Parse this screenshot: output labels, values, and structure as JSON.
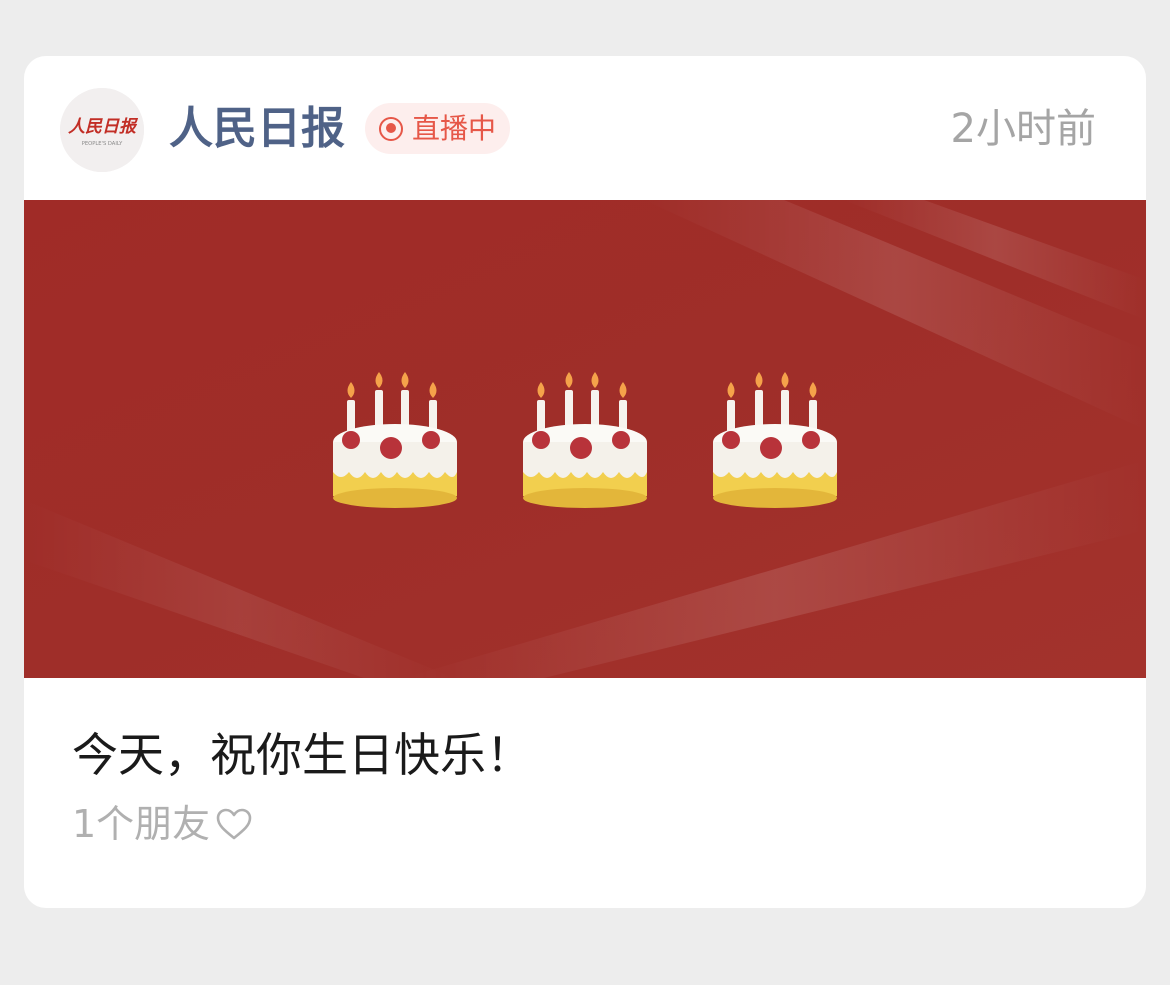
{
  "post": {
    "account_name": "人民日报",
    "avatar_text": "人民日报",
    "avatar_subtext": "PEOPLE'S DAILY",
    "live_label": "直播中",
    "timestamp": "2小时前",
    "banner_icons": [
      "birthday-cake",
      "birthday-cake",
      "birthday-cake"
    ],
    "title": "今天，祝你生日快乐！",
    "friends_label": "1个朋友",
    "heart_icon": "heart-outline-icon"
  },
  "colors": {
    "background": "#ededed",
    "account_name": "#4f6287",
    "live_accent": "#e65748",
    "live_badge_bg": "#fdeeed",
    "banner_red": "#a02f2a",
    "muted_text": "#a5a5a5",
    "title_text": "#1a1a1a"
  }
}
